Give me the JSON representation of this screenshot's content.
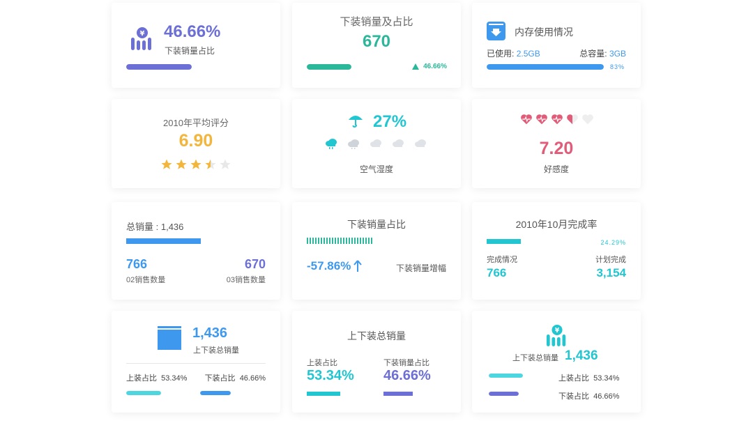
{
  "colors": {
    "purple": "#6c6fd6",
    "teal": "#2bb79a",
    "blue": "#3e99ee",
    "gold": "#f2b63d",
    "red": "#e05c78",
    "cyan": "#22c6d0"
  },
  "card1": {
    "value": "46.66%",
    "label": "下装销量占比",
    "icon": "money-chart-icon",
    "progress": 0.4666
  },
  "card2": {
    "title": "下装销量及占比",
    "value": "670",
    "trend": "46.66%",
    "progress": 0.4666
  },
  "card3": {
    "title": "内存使用情况",
    "used_label": "已使用:",
    "used_value": "2.5GB",
    "total_label": "总容量:",
    "total_value": "3GB",
    "percent": "83%",
    "progress": 0.83
  },
  "card4": {
    "title": "2010年平均评分",
    "value": "6.90",
    "rating": 3.5,
    "rating_max": 5
  },
  "card5": {
    "value": "27%",
    "label": "空气湿度",
    "icon": "umbrella-icon",
    "weather_icons": [
      "rain-cloud-icon",
      "cloud-icon",
      "cloud-icon",
      "cloud-icon",
      "cloud-icon"
    ]
  },
  "card6": {
    "value": "7.20",
    "label": "好感度",
    "hearts": 3.5,
    "hearts_max": 5
  },
  "card7": {
    "title": "总销量 :",
    "title_value": "1,436",
    "left_value": "766",
    "left_label": "02销售数量",
    "right_value": "670",
    "right_label": "03销售数量",
    "progress": 0.53
  },
  "card8": {
    "title": "下装销量占比",
    "value": "-57.86%",
    "label": "下装销量增幅",
    "progress": 0.4666
  },
  "card9": {
    "title": "2010年10月完成率",
    "percent": "24.29%",
    "left_label": "完成情况",
    "left_value": "766",
    "right_label": "计划完成",
    "right_value": "3,154",
    "progress": 0.2429
  },
  "card10": {
    "value": "1,436",
    "label": "上下装总销量",
    "icon": "box-icon",
    "left_label": "上装占比",
    "left_value": "53.34%",
    "right_label": "下装占比",
    "right_value": "46.66%",
    "left_progress": 0.5334,
    "right_progress": 0.4666
  },
  "card11": {
    "title": "上下装总销量",
    "left_label": "上装占比",
    "left_value": "53.34%",
    "right_label": "下装销量占比",
    "right_value": "46.66%",
    "left_progress": 0.5334,
    "right_progress": 0.4666
  },
  "card12": {
    "label": "上下装总销量",
    "value": "1,436",
    "icon": "money-chart-icon",
    "row1_label": "上装占比",
    "row1_value": "53.34%",
    "row2_label": "下装占比",
    "row2_value": "46.66%",
    "row1_progress": 0.5334,
    "row2_progress": 0.4666
  }
}
